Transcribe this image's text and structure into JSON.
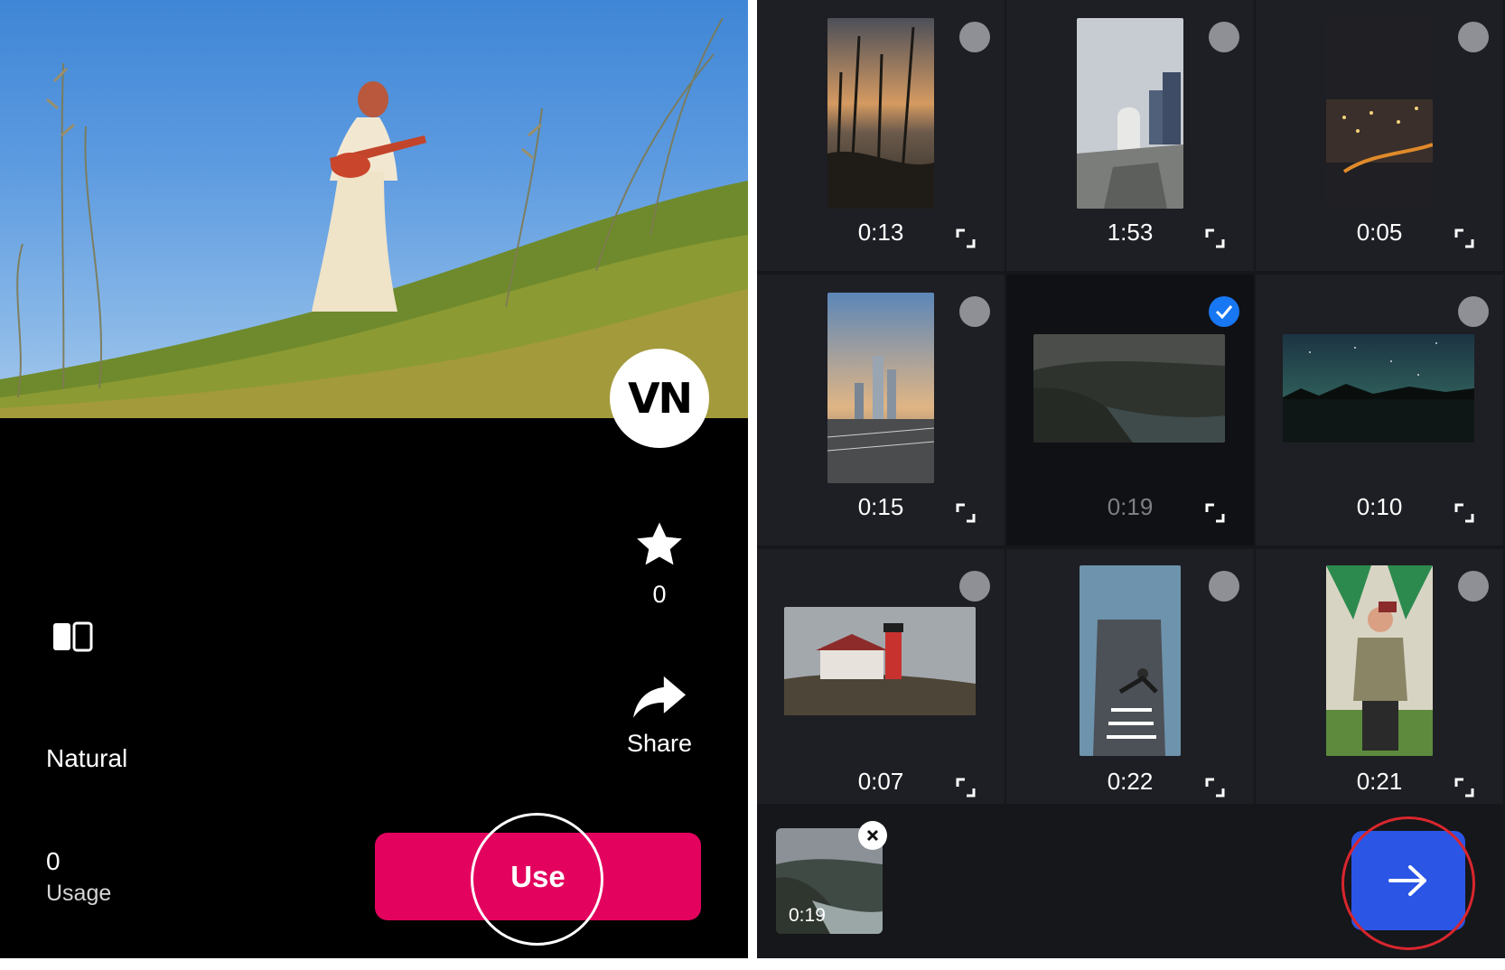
{
  "left_panel": {
    "logo_text": "VN",
    "favorite": {
      "count": "0",
      "icon": "star-icon"
    },
    "share": {
      "label": "Share",
      "icon": "share-arrow-icon"
    },
    "compare_icon": "split-compare-icon",
    "filter_name": "Natural",
    "usage": {
      "count": "0",
      "label": "Usage"
    },
    "use_button_label": "Use",
    "accent_color": "#e3035f"
  },
  "right_panel": {
    "grid": [
      {
        "duration": "0:13",
        "selected": false,
        "scene": "sunset-silhouette-plants"
      },
      {
        "duration": "1:53",
        "selected": false,
        "scene": "merlion-statue-city"
      },
      {
        "duration": "0:05",
        "selected": false,
        "scene": "night-city-lights"
      },
      {
        "duration": "0:15",
        "selected": false,
        "scene": "skyscrapers-highway"
      },
      {
        "duration": "0:19",
        "selected": true,
        "scene": "coastline-waves"
      },
      {
        "duration": "0:10",
        "selected": false,
        "scene": "starry-night-lake"
      },
      {
        "duration": "0:07",
        "selected": false,
        "scene": "lighthouse-cliff"
      },
      {
        "duration": "0:22",
        "selected": false,
        "scene": "breakdancer-street"
      },
      {
        "duration": "0:21",
        "selected": false,
        "scene": "person-mural-wall"
      }
    ],
    "selected_tray": {
      "duration": "0:19",
      "remove_icon": "close-icon"
    },
    "next_icon": "arrow-right-icon",
    "accent_color": "#2a55e5",
    "check_color": "#1877f2"
  }
}
